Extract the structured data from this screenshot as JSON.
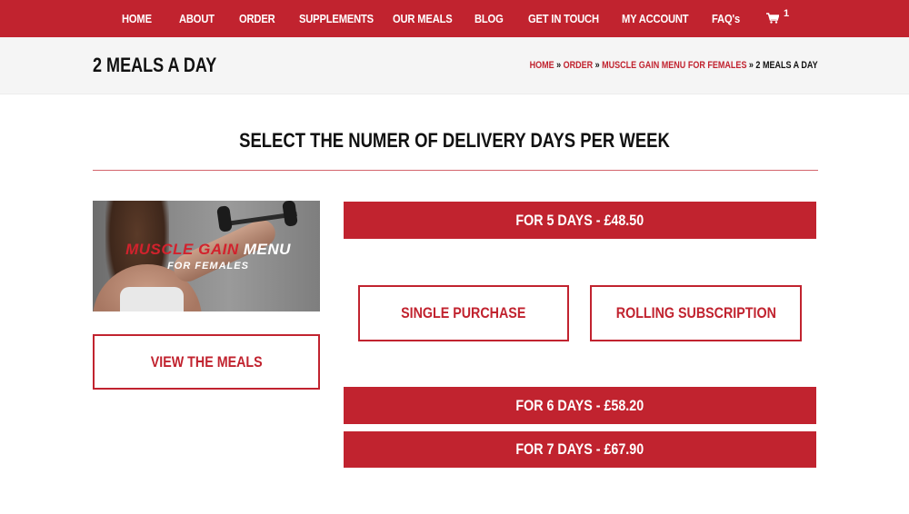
{
  "nav": {
    "items": [
      {
        "label": "HOME"
      },
      {
        "label": "ABOUT"
      },
      {
        "label": "ORDER"
      },
      {
        "label": "SUPPLEMENTS"
      },
      {
        "label": "OUR MEALS"
      },
      {
        "label": "BLOG"
      },
      {
        "label": "GET IN TOUCH"
      },
      {
        "label": "MY ACCOUNT"
      },
      {
        "label": "FAQ's"
      }
    ],
    "cart_icon": "shopping-cart-icon",
    "cart_count": "1"
  },
  "header": {
    "title": "2 MEALS A DAY",
    "breadcrumb": {
      "links": [
        "HOME",
        "ORDER",
        "MUSCLE GAIN MENU FOR FEMALES"
      ],
      "separator": "»",
      "current": "2 MEALS A DAY"
    }
  },
  "main": {
    "heading": "SELECT THE NUMER OF DELIVERY DAYS PER WEEK",
    "promo": {
      "line1_part1": "MUSCLE GAIN",
      "line1_part2": "MENU",
      "line2": "FOR FEMALES"
    },
    "view_meals_label": "VIEW THE MEALS",
    "options": [
      {
        "label": "FOR 5 DAYS - £48.50"
      },
      {
        "label": "FOR 6 DAYS - £58.20"
      },
      {
        "label": "FOR 7 DAYS - £67.90"
      }
    ],
    "purchase_types": {
      "single": "SINGLE PURCHASE",
      "rolling": "ROLLING SUBSCRIPTION"
    }
  },
  "colors": {
    "brand_red": "#c1232f",
    "header_bg": "#f5f5f5",
    "text_dark": "#111111"
  }
}
